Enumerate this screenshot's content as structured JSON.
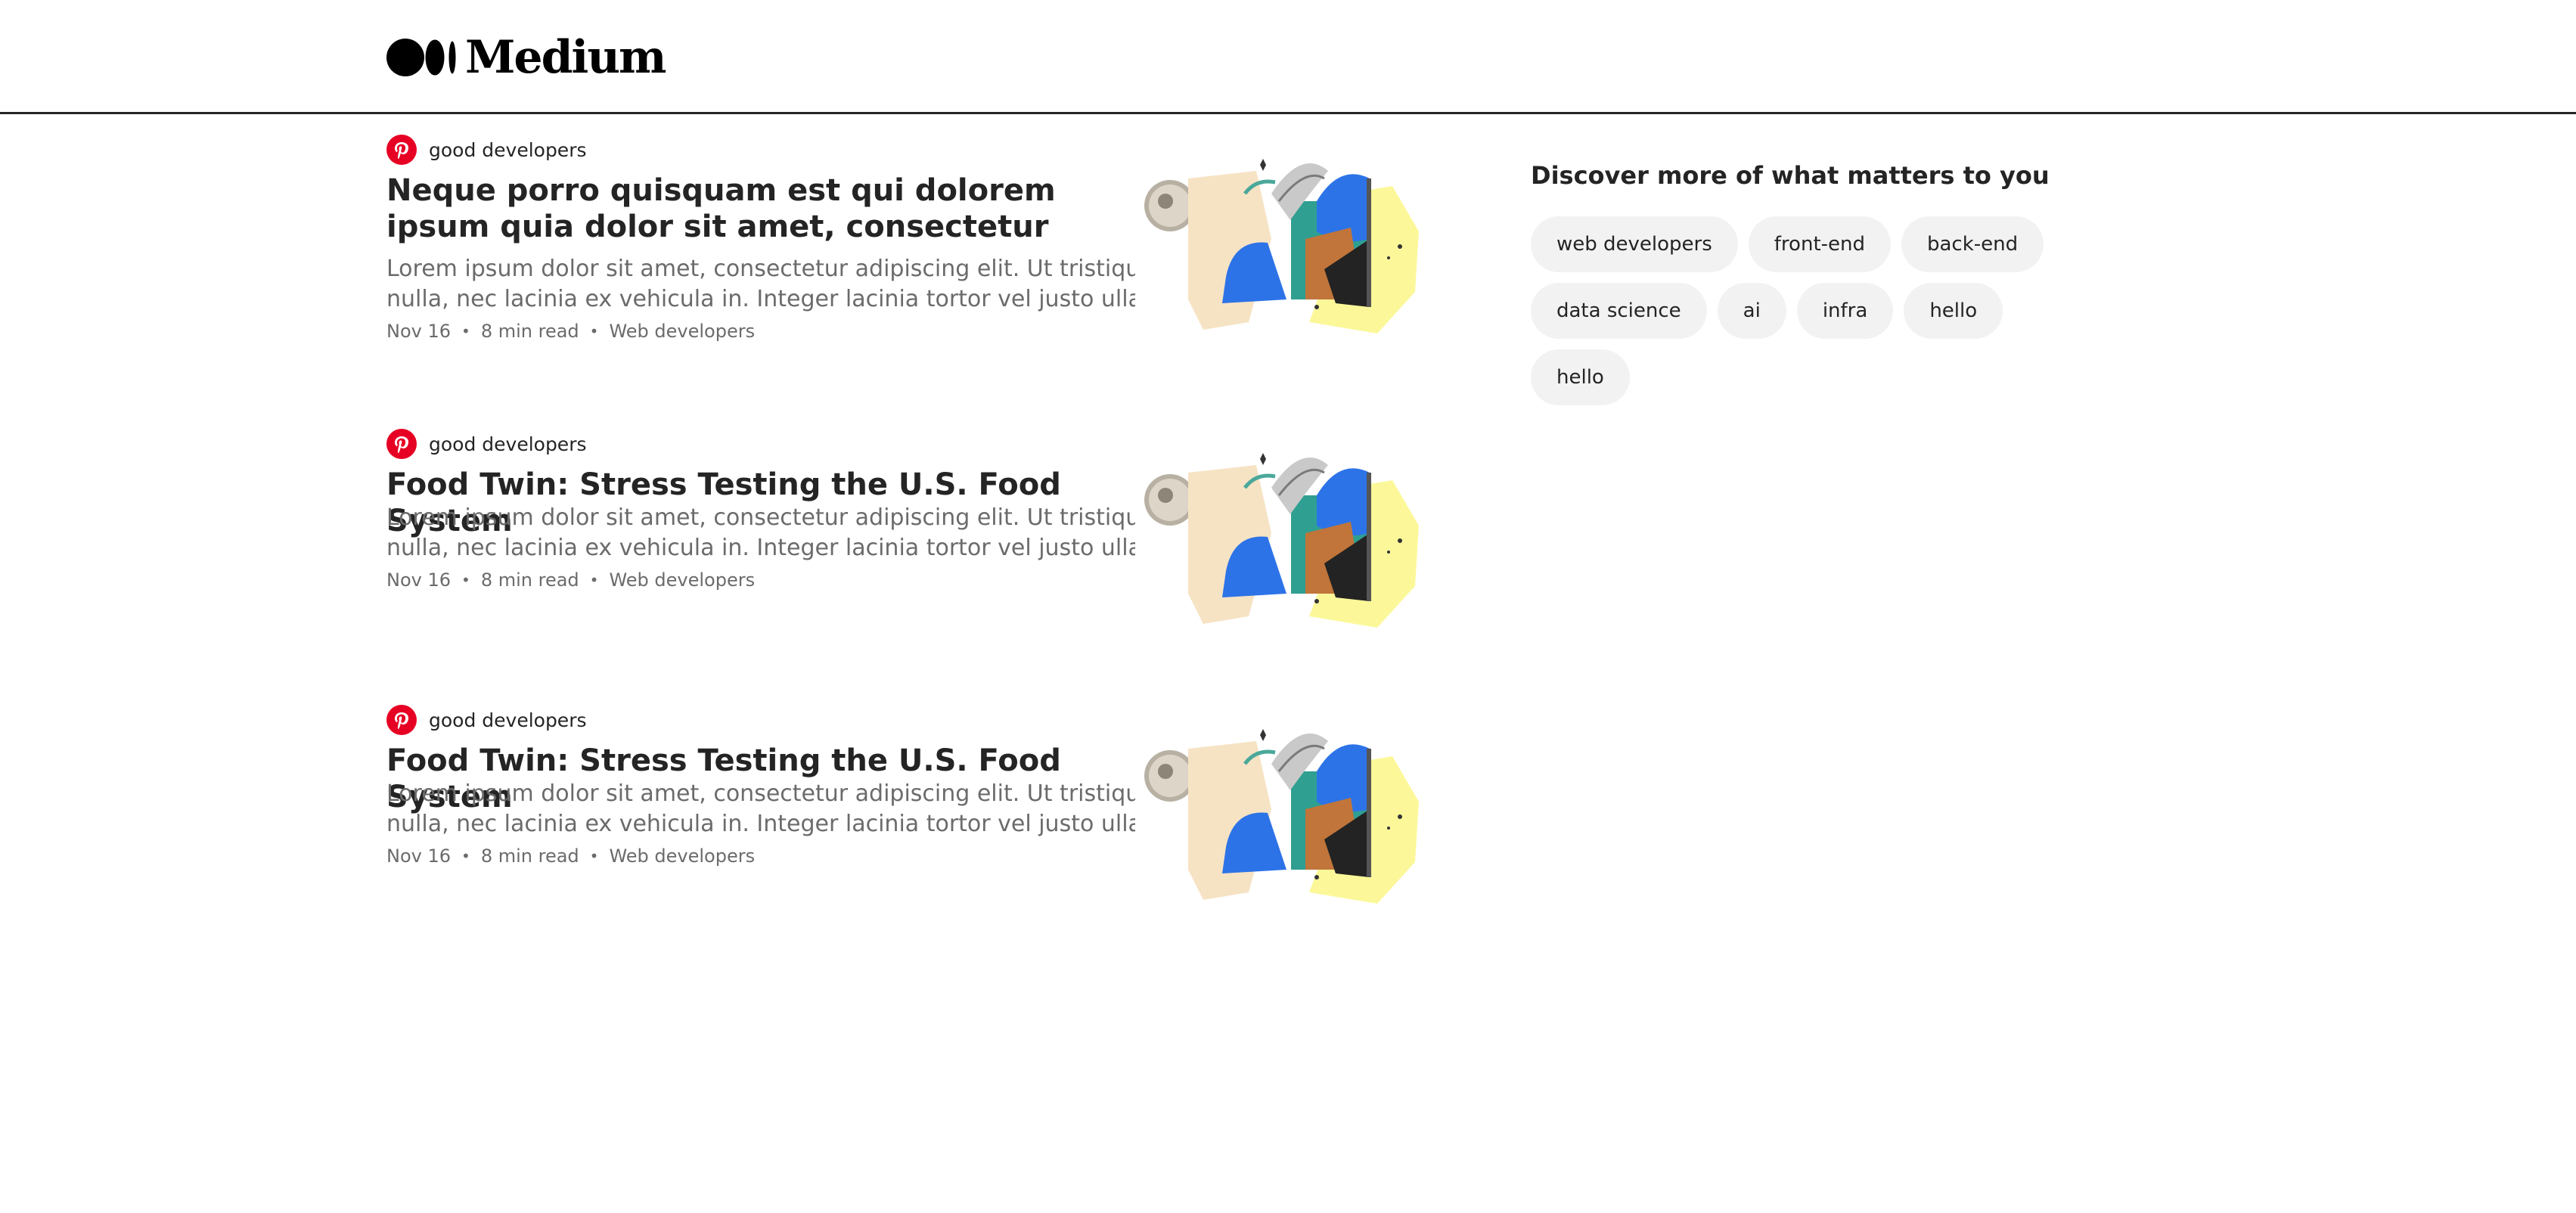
{
  "header": {
    "logo_text": "Medium"
  },
  "articles": [
    {
      "publication": "good developers",
      "title": "Neque porro quisquam est qui dolorem ipsum quia dolor sit amet, consectetur",
      "description_line1": "Lorem ipsum dolor sit amet, consectetur adipiscing elit. Ut tristique porta",
      "description_line2": "nulla, nec lacinia ex vehicula in. Integer lacinia tortor vel justo ullamcorper",
      "date": "Nov 16",
      "read_time": "8 min read",
      "tag": "Web developers",
      "separator": "•"
    },
    {
      "publication": "good developers",
      "title": "Food Twin: Stress Testing the U.S. Food System",
      "description_line1": "Lorem ipsum dolor sit amet, consectetur adipiscing elit. Ut tristique porta",
      "description_line2": "nulla, nec lacinia ex vehicula in. Integer lacinia tortor vel justo ullamcorper",
      "date": "Nov 16",
      "read_time": "8 min read",
      "tag": "Web developers",
      "separator": "•"
    },
    {
      "publication": "good developers",
      "title": "Food Twin: Stress Testing the U.S. Food System",
      "description_line1": "Lorem ipsum dolor sit amet, consectetur adipiscing elit. Ut tristique porta",
      "description_line2": "nulla, nec lacinia ex vehicula in. Integer lacinia tortor vel justo ullamcorper",
      "date": "Nov 16",
      "read_time": "8 min read",
      "tag": "Web developers",
      "separator": "•"
    }
  ],
  "sidebar": {
    "heading": "Discover more of what matters to you",
    "topics": [
      "web developers",
      "front-end",
      "back-end",
      "data science",
      "ai",
      "infra",
      "hello",
      "hello"
    ]
  },
  "colors": {
    "accent_pinterest": "#e60023",
    "chip_bg": "#f2f2f2",
    "text_primary": "#242424",
    "text_secondary": "#6b6b6b"
  },
  "icons": {
    "publication_avatar": "pinterest-logo-icon",
    "logo_mark": "medium-logo-icon"
  }
}
